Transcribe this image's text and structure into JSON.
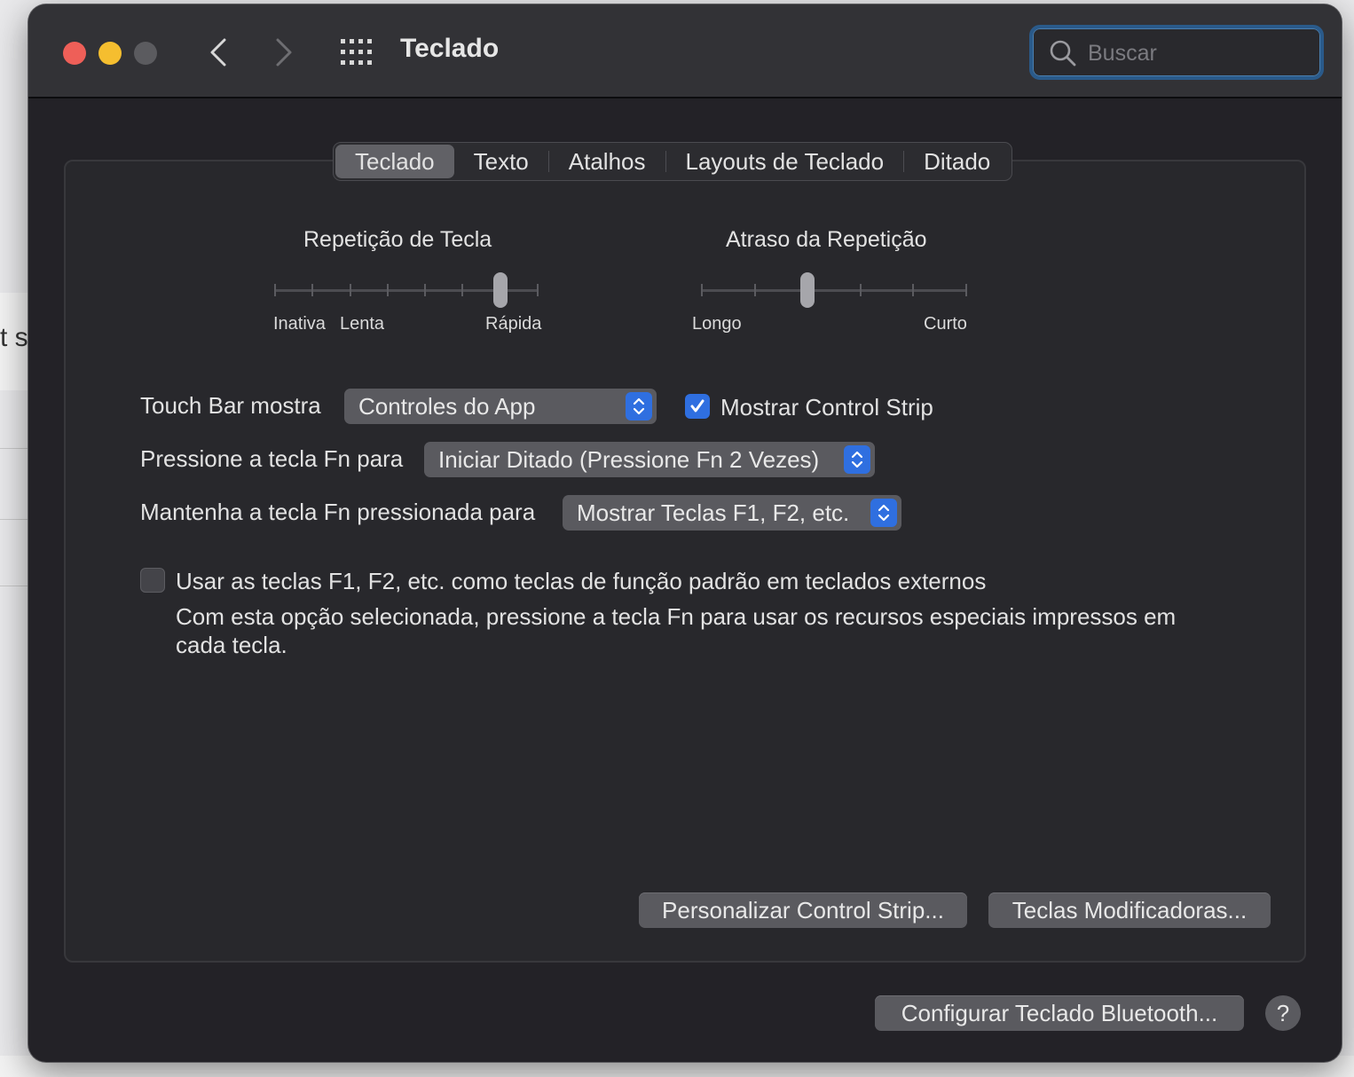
{
  "window": {
    "title": "Teclado",
    "search_placeholder": "Buscar",
    "icons": [
      "close-button",
      "minimize-button",
      "zoom-button",
      "chevron-left-icon",
      "chevron-right-icon",
      "grid-icon",
      "search-icon"
    ]
  },
  "background": {
    "partial_text": "t s"
  },
  "tabs": [
    {
      "label": "Teclado",
      "selected": true
    },
    {
      "label": "Texto",
      "selected": false
    },
    {
      "label": "Atalhos",
      "selected": false
    },
    {
      "label": "Layouts de Teclado",
      "selected": false
    },
    {
      "label": "Ditado",
      "selected": false
    }
  ],
  "key_repeat": {
    "label": "Repetição de Tecla",
    "captions": [
      "Inativa",
      "Lenta",
      "Rápida"
    ],
    "steps": 8,
    "selected_step": 7
  },
  "repeat_delay": {
    "label": "Atraso da Repetição",
    "captions": [
      "Longo",
      "Curto"
    ],
    "steps": 6,
    "selected_step": 3
  },
  "touch_bar": {
    "label": "Touch Bar mostra",
    "value": "Controles do App",
    "control_strip_label": "Mostrar Control Strip",
    "control_strip_checked": true
  },
  "fn_press": {
    "label": "Pressione a tecla Fn para",
    "value": "Iniciar Ditado (Pressione Fn 2 Vezes)"
  },
  "fn_hold": {
    "label": "Mantenha a tecla Fn pressionada para",
    "value": "Mostrar Teclas F1, F2, etc."
  },
  "function_keys": {
    "label": "Usar as teclas F1, F2, etc. como teclas de função padrão em teclados externos",
    "checked": false,
    "description_line1": "Com esta opção selecionada, pressione a tecla Fn para usar os recursos especiais impressos em",
    "description_line2": "cada tecla."
  },
  "buttons": {
    "customize_control_strip": "Personalizar Control Strip...",
    "modifier_keys": "Teclas Modificadoras...",
    "bluetooth_keyboard": "Configurar Teclado Bluetooth...",
    "help": "?"
  },
  "colors": {
    "window_bg": "#232227",
    "titlebar_bg": "#323236",
    "accent_blue": "#2f6fe0",
    "close_red": "#ee5f58",
    "minimize_yellow": "#f5be2f"
  }
}
